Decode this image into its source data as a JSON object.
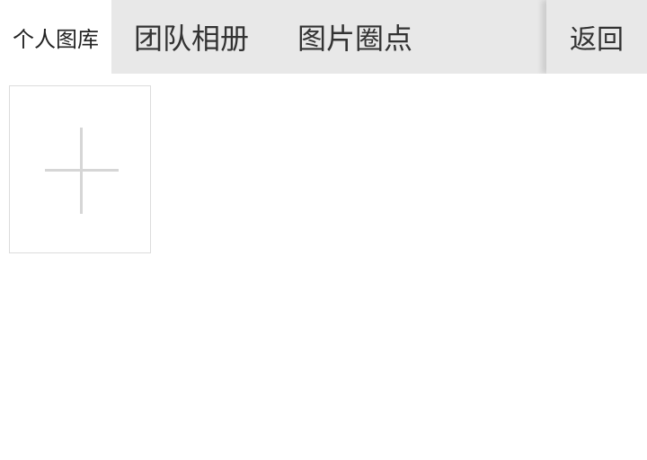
{
  "tabs": [
    {
      "label": "个人图库",
      "active": true
    },
    {
      "label": "团队相册",
      "active": false
    },
    {
      "label": "图片圈点",
      "active": false
    }
  ],
  "back_label": "返回",
  "gallery": {
    "add_icon": "plus-icon"
  },
  "colors": {
    "tabbar_bg": "#e8e8e8",
    "active_tab_bg": "#ffffff",
    "plus_color": "#d6d6d6"
  }
}
